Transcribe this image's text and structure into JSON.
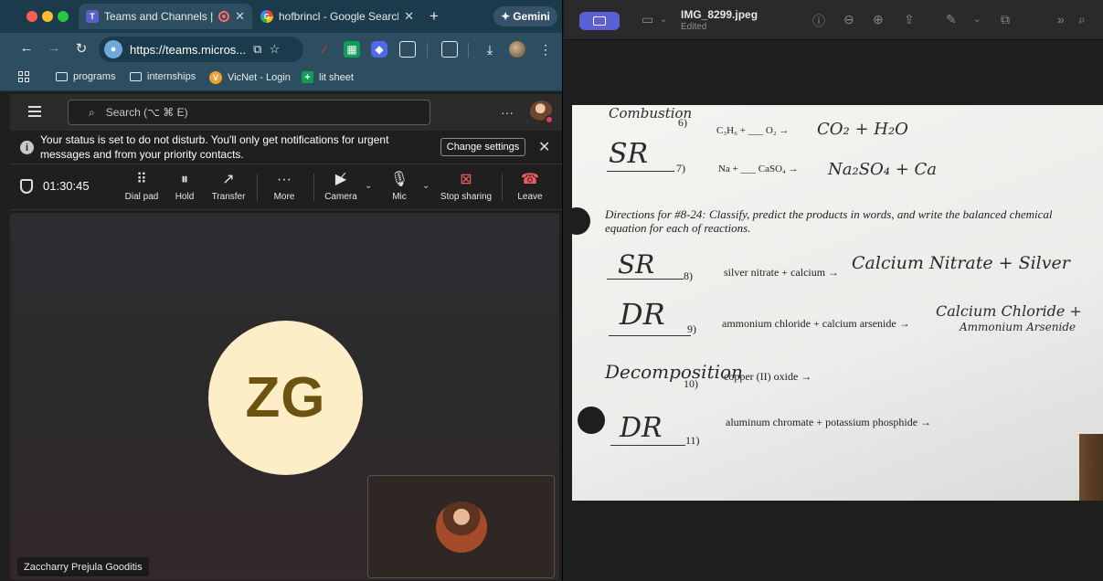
{
  "browser": {
    "tabs": [
      {
        "label": "Teams and Channels | ",
        "active": true
      },
      {
        "label": "hofbrincl - Google Search",
        "active": false
      }
    ],
    "gemini_label": "Gemini",
    "url": "https://teams.micros...",
    "bookmarks": [
      "programs",
      "internships",
      "VicNet - Login",
      "lit sheet"
    ]
  },
  "teams": {
    "search_placeholder": "Search (⌥ ⌘ E)",
    "notice": {
      "text": "Your status is set to do not disturb. You'll only get notifications for urgent messages and from your priority contacts.",
      "button": "Change settings"
    },
    "call": {
      "timer": "01:30:45",
      "buttons": [
        "Dial pad",
        "Hold",
        "Transfer",
        "More",
        "Camera",
        "Mic",
        "Stop sharing",
        "Leave"
      ]
    },
    "participant_initials": "ZG",
    "participant_name": "Zaccharry Prejula Gooditis"
  },
  "preview": {
    "title": "IMG_8299.jpeg",
    "subtitle": "Edited",
    "worksheet": {
      "top_label": "Combustion",
      "q6": {
        "num": "6)",
        "eq": "C₃H₆ + ___ O₂ →",
        "answer": "CO₂ + H₂O"
      },
      "q7": {
        "num": "7)",
        "label": "SR",
        "eq": "Na + ___ CaSO₄ →",
        "answer": "Na₂SO₄ + Ca"
      },
      "directions": "Directions for #8-24: Classify, predict the products in words, and write the balanced chemical equation for each of reactions.",
      "q8": {
        "num": "8)",
        "label": "SR",
        "eq": "silver nitrate + calcium →",
        "answer": "Calcium Nitrate + Silver"
      },
      "q9": {
        "num": "9)",
        "label": "DR",
        "eq": "ammonium chloride + calcium arsenide →",
        "answer_1": "Calcium Chloride +",
        "answer_2": "Ammonium Arsenide"
      },
      "q10": {
        "num": "10)",
        "label": "Decomposition",
        "eq": "copper (II) oxide →"
      },
      "q11": {
        "num": "11)",
        "label": "DR",
        "eq": "aluminum chromate + potassium phosphide →"
      }
    }
  }
}
